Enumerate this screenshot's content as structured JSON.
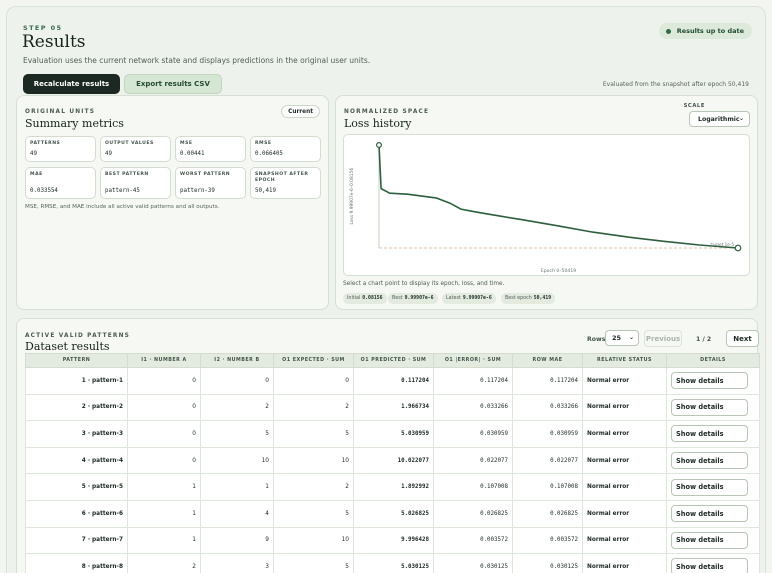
{
  "header": {
    "step": "STEP 05",
    "title": "Results",
    "subtitle": "Evaluation uses the current network state and displays predictions in the original user units.",
    "status": "Results up to date",
    "recalculate_label": "Recalculate results",
    "export_label": "Export results CSV",
    "evaluated_note": "Evaluated from the snapshot after epoch 50,419"
  },
  "summary": {
    "eyebrow": "ORIGINAL UNITS",
    "title": "Summary metrics",
    "badge": "Current",
    "metrics": [
      {
        "label": "PATTERNS",
        "value": "49"
      },
      {
        "label": "OUTPUT VALUES",
        "value": "49"
      },
      {
        "label": "MSE",
        "value": "0.00441"
      },
      {
        "label": "RMSE",
        "value": "0.066405"
      },
      {
        "label": "MAE",
        "value": "0.033554"
      },
      {
        "label": "BEST PATTERN",
        "value": "pattern-45"
      },
      {
        "label": "WORST PATTERN",
        "value": "pattern-39"
      },
      {
        "label": "SNAPSHOT AFTER EPOCH",
        "value": "50,419"
      }
    ],
    "note": "MSE, RMSE, and MAE include all active valid patterns and all outputs."
  },
  "loss": {
    "eyebrow": "NORMALIZED SPACE",
    "title": "Loss history",
    "scale_label": "SCALE",
    "scale_value": "Logarithmic",
    "hint": "Select a chart point to display its epoch, loss, and time.",
    "stats": [
      {
        "label": "Initial",
        "value": "0.08156"
      },
      {
        "label": "Best",
        "value": "9.99907e-6"
      },
      {
        "label": "Latest",
        "value": "9.99907e-6"
      },
      {
        "label": "Best epoch",
        "value": "50,419"
      }
    ]
  },
  "chart_data": {
    "type": "line",
    "title": "",
    "xlabel": "Epoch 0–50419",
    "ylabel": "Loss 9.99907e-6–0.08156",
    "target_label": "target 1e-5",
    "log_scale": true,
    "xlim": [
      0,
      50419
    ],
    "ylim": [
      9.99907e-06,
      0.08156
    ],
    "grid": false,
    "target": 1e-05,
    "series": [
      {
        "x": [
          0,
          300,
          1500,
          4000,
          8000,
          10000,
          11500,
          13000,
          15000,
          20000,
          25000,
          30000,
          35000,
          40000,
          45000,
          50419
        ],
        "values": [
          0.08156,
          0.0018,
          0.0012,
          0.0011,
          0.0008,
          0.0005,
          0.0003,
          0.00025,
          0.0002,
          0.00012,
          7e-05,
          4e-05,
          2.6e-05,
          1.8e-05,
          1.3e-05,
          9.99907e-06
        ],
        "color": "#2d5e3e"
      }
    ]
  },
  "table": {
    "eyebrow": "ACTIVE VALID PATTERNS",
    "title": "Dataset results",
    "rows_label": "Rows",
    "rows_value": "25",
    "prev_label": "Previous",
    "page_indicator": "1 / 2",
    "next_label": "Next",
    "details_label": "Show details",
    "columns": [
      "PATTERN",
      "I1 · NUMBER A",
      "I2 · NUMBER B",
      "O1 EXPECTED · SUM",
      "O1 PREDICTED · SUM",
      "O1 |ERROR| · SUM",
      "ROW MAE",
      "RELATIVE STATUS",
      "DETAILS"
    ],
    "rows": [
      {
        "pattern": "1 · pattern-1",
        "a": "0",
        "b": "0",
        "expected": "0",
        "predicted": "0.117204",
        "error": "0.117204",
        "mae": "0.117204",
        "status": "Normal error"
      },
      {
        "pattern": "2 · pattern-2",
        "a": "0",
        "b": "2",
        "expected": "2",
        "predicted": "1.966734",
        "error": "0.033266",
        "mae": "0.033266",
        "status": "Normal error"
      },
      {
        "pattern": "3 · pattern-3",
        "a": "0",
        "b": "5",
        "expected": "5",
        "predicted": "5.030959",
        "error": "0.030959",
        "mae": "0.030959",
        "status": "Normal error"
      },
      {
        "pattern": "4 · pattern-4",
        "a": "0",
        "b": "10",
        "expected": "10",
        "predicted": "10.022077",
        "error": "0.022077",
        "mae": "0.022077",
        "status": "Normal error"
      },
      {
        "pattern": "5 · pattern-5",
        "a": "1",
        "b": "1",
        "expected": "2",
        "predicted": "1.892992",
        "error": "0.107008",
        "mae": "0.107008",
        "status": "Normal error"
      },
      {
        "pattern": "6 · pattern-6",
        "a": "1",
        "b": "4",
        "expected": "5",
        "predicted": "5.026825",
        "error": "0.026825",
        "mae": "0.026825",
        "status": "Normal error"
      },
      {
        "pattern": "7 · pattern-7",
        "a": "1",
        "b": "9",
        "expected": "10",
        "predicted": "9.996428",
        "error": "0.003572",
        "mae": "0.003572",
        "status": "Normal error"
      },
      {
        "pattern": "8 · pattern-8",
        "a": "2",
        "b": "3",
        "expected": "5",
        "predicted": "5.030125",
        "error": "0.030125",
        "mae": "0.030125",
        "status": "Normal error"
      }
    ]
  }
}
